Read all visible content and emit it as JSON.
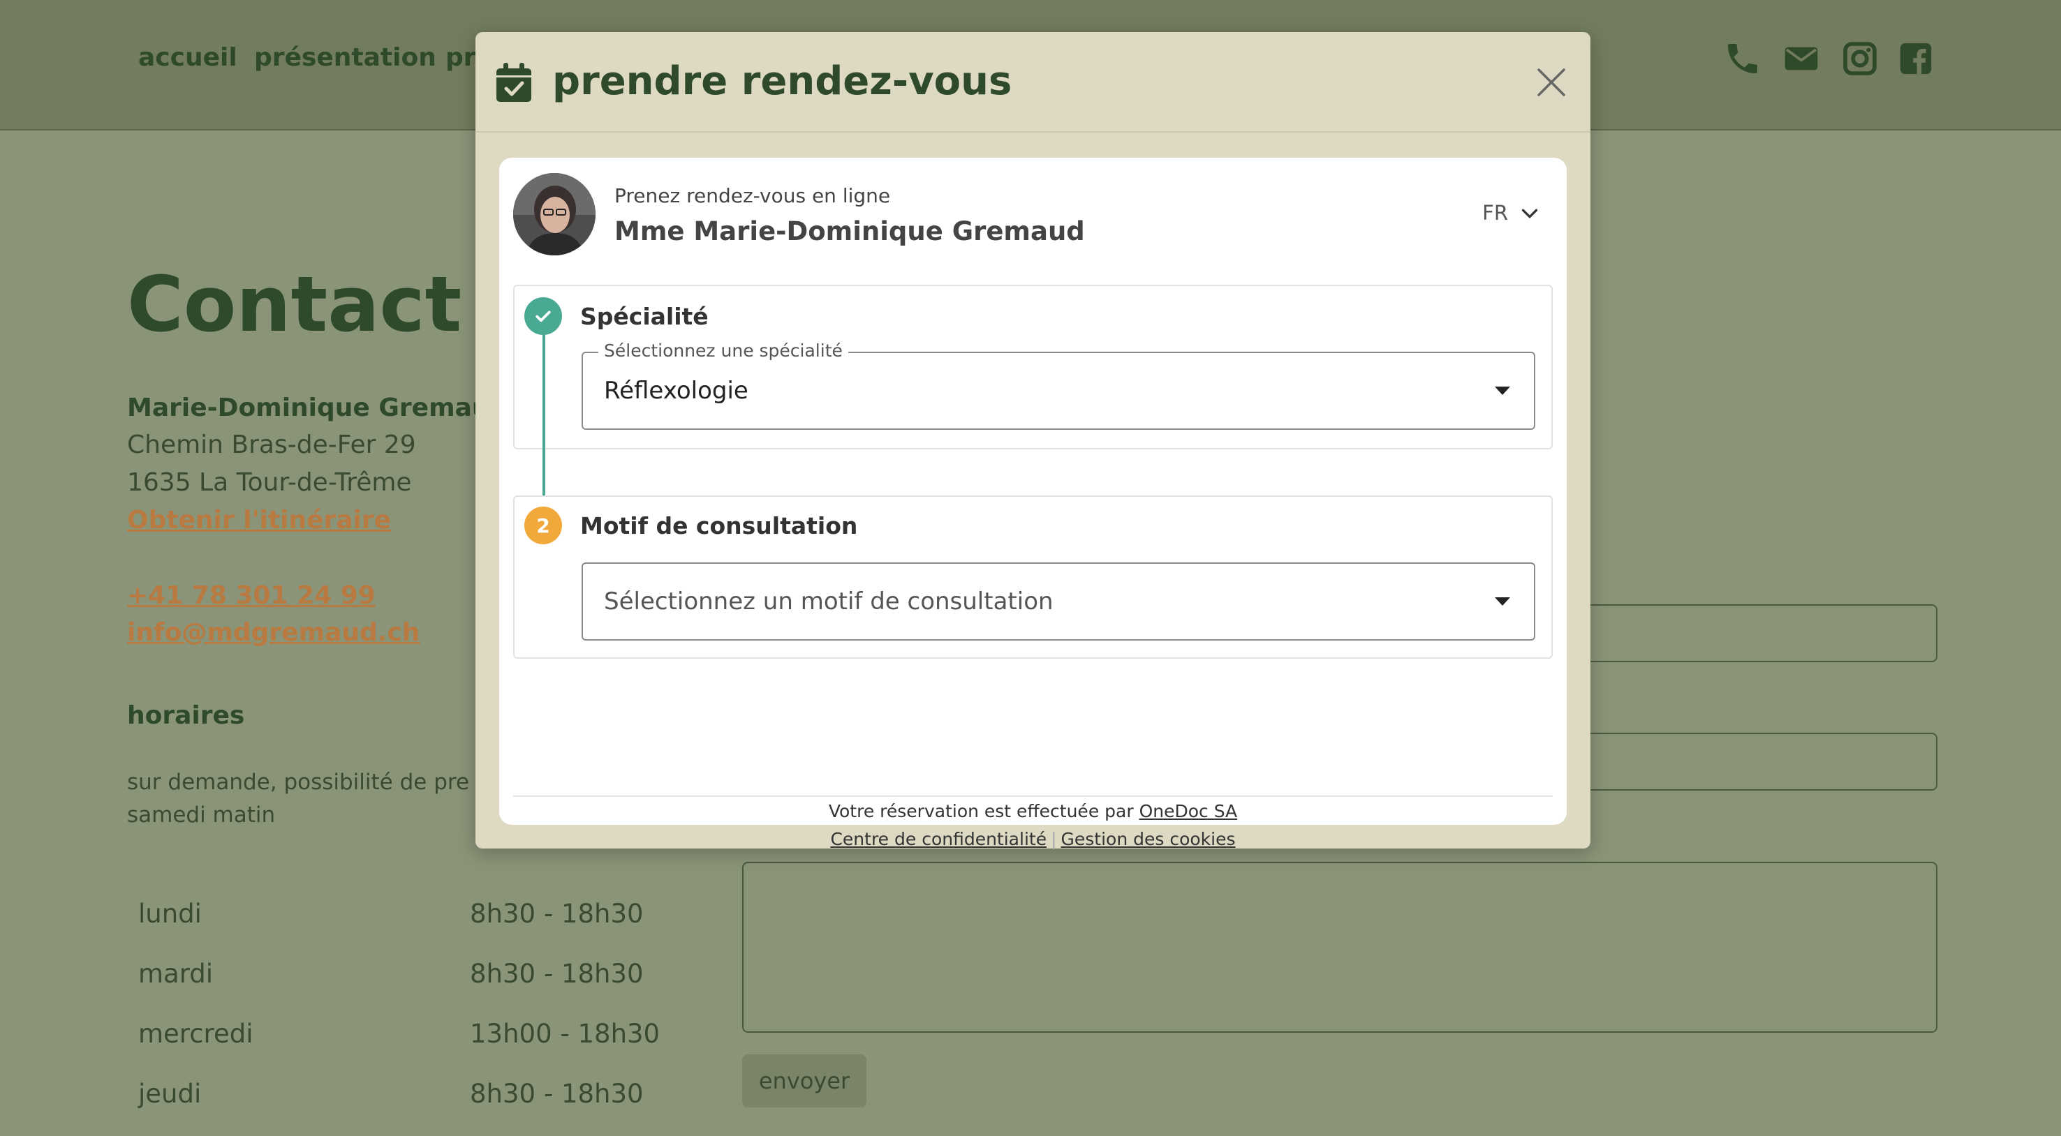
{
  "nav": {
    "links": [
      "accueil",
      "présentation",
      "pr"
    ],
    "icons": [
      "phone-icon",
      "envelope-icon",
      "instagram-icon",
      "facebook-icon"
    ]
  },
  "contact": {
    "title": "Contact",
    "name": "Marie-Dominique Gremaud",
    "street": "Chemin Bras-de-Fer 29",
    "city": "1635 La Tour-de-Trême",
    "itinerary_link": "Obtenir l'itinéraire",
    "phone": "+41 78 301 24 99",
    "email": "info@mdgremaud.ch",
    "hours_heading": "horaires",
    "note_line1": "sur demande, possibilité de pre",
    "note_line2": "samedi matin",
    "hours": [
      {
        "day": "lundi",
        "time": "8h30 - 18h30"
      },
      {
        "day": "mardi",
        "time": "8h30 - 18h30"
      },
      {
        "day": "mercredi",
        "time": "13h00 - 18h30"
      },
      {
        "day": "jeudi",
        "time": "8h30 - 18h30"
      }
    ]
  },
  "form": {
    "send_label": "envoyer"
  },
  "modal": {
    "title": "prendre rendez-vous",
    "widget": {
      "subtitle": "Prenez rendez-vous en ligne",
      "practitioner": "Mme Marie-Dominique Gremaud",
      "language": "FR",
      "step1": {
        "title": "Spécialité",
        "legend": "Sélectionnez une spécialité",
        "value": "Réflexologie"
      },
      "step2": {
        "number": "2",
        "title": "Motif de consultation",
        "placeholder": "Sélectionnez un motif de consultation"
      },
      "footer": {
        "prefix": "Votre réservation est effectuée par",
        "provider": "OneDoc SA",
        "privacy": "Centre de confidentialité",
        "cookies": "Gestion des cookies"
      }
    }
  },
  "colors": {
    "page_bg": "#8a9478",
    "topbar_bg": "#727c5e",
    "brand_green": "#2f4a2a",
    "link_orange": "#b87a40",
    "modal_bg": "#ddd9c3",
    "step_done": "#4aa992",
    "step_pending": "#f0a93a"
  }
}
